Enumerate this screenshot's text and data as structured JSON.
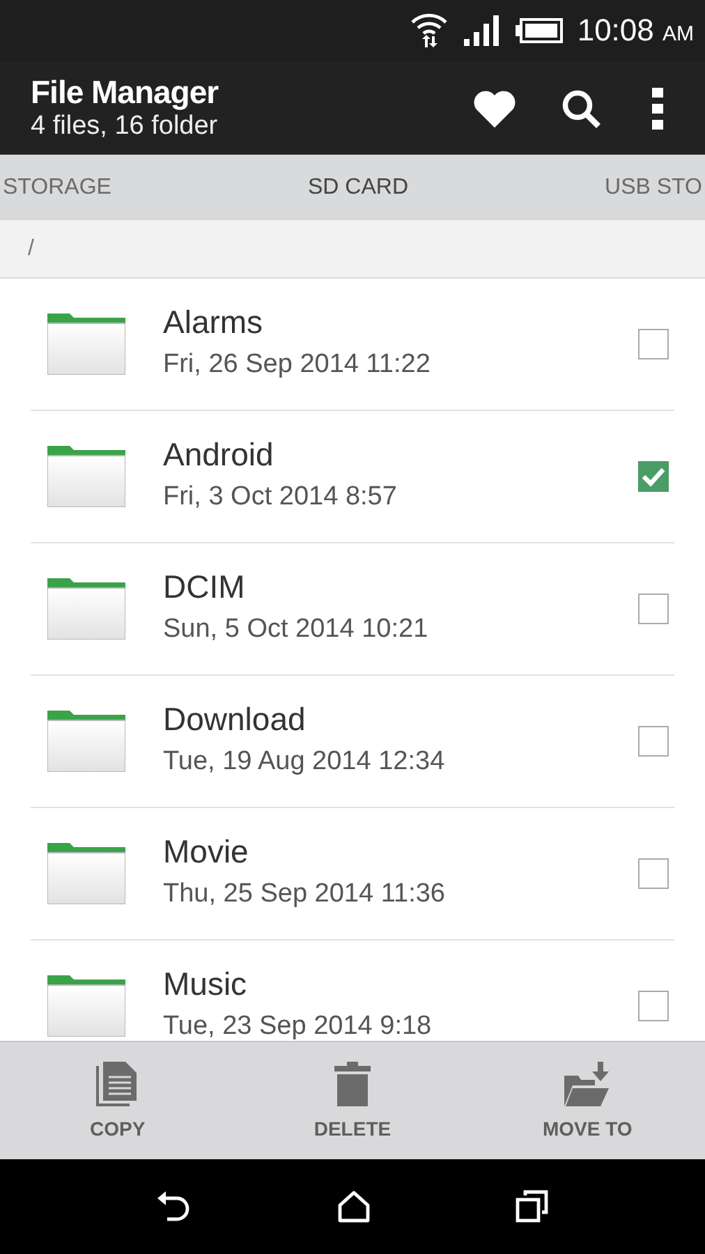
{
  "status_bar": {
    "time": "10:08",
    "meridiem": "AM"
  },
  "app_bar": {
    "title": "File Manager",
    "subtitle": "4 files, 16 folder"
  },
  "tabs": [
    {
      "label": "STORAGE",
      "selected": false
    },
    {
      "label": "SD CARD",
      "selected": true
    },
    {
      "label": "USB STO",
      "selected": false
    }
  ],
  "path": "/",
  "folders": [
    {
      "name": "Alarms",
      "date": "Fri, 26 Sep 2014 11:22",
      "checked": false
    },
    {
      "name": "Android",
      "date": "Fri, 3 Oct 2014 8:57",
      "checked": true
    },
    {
      "name": "DCIM",
      "date": "Sun, 5 Oct 2014 10:21",
      "checked": false
    },
    {
      "name": "Download",
      "date": "Tue, 19 Aug 2014 12:34",
      "checked": false
    },
    {
      "name": "Movie",
      "date": "Thu, 25 Sep 2014 11:36",
      "checked": false
    },
    {
      "name": "Music",
      "date": "Tue, 23 Sep 2014 9:18",
      "checked": false
    }
  ],
  "actions": [
    {
      "kind": "copy",
      "label": "COPY"
    },
    {
      "kind": "delete",
      "label": "DELETE"
    },
    {
      "kind": "move",
      "label": "MOVE TO"
    }
  ]
}
